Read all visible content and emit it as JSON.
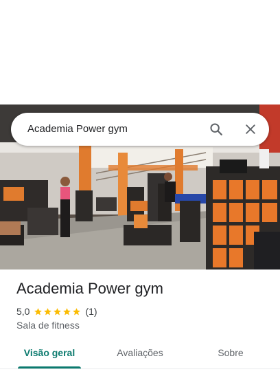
{
  "search": {
    "query": "Academia Power gym",
    "search_icon": "search-icon",
    "close_icon": "close-icon"
  },
  "photo": {
    "subject": "gym-interior-photo"
  },
  "place": {
    "title": "Academia Power gym",
    "rating": "5,0",
    "stars": 5,
    "review_count": "(1)",
    "category": "Sala de fitness",
    "star_color": "#fbbc04"
  },
  "tabs": [
    {
      "label": "Visão geral",
      "active": true
    },
    {
      "label": "Avaliações",
      "active": false
    },
    {
      "label": "Sobre",
      "active": false
    }
  ],
  "colors": {
    "accent": "#0b7a6e",
    "text_primary": "#202124",
    "text_secondary": "#5f6368"
  }
}
